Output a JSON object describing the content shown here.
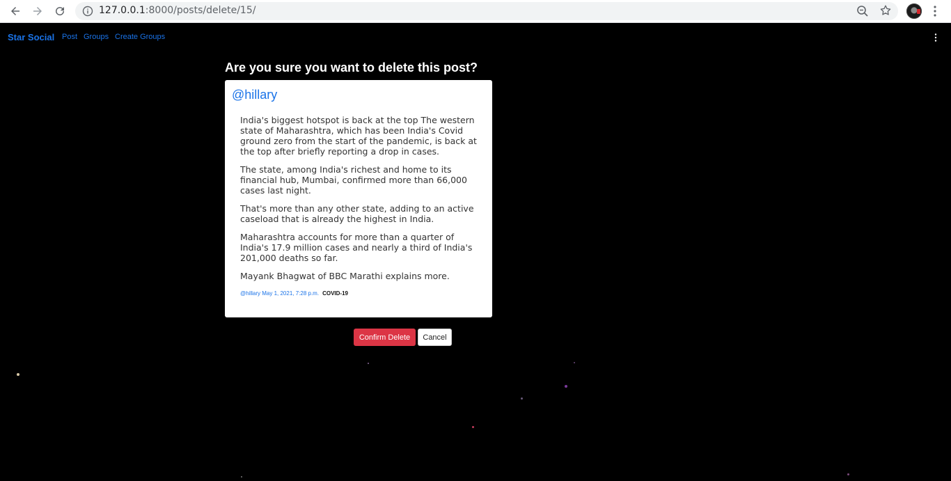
{
  "browser": {
    "url_host": "127.0.0.1",
    "url_path": ":8000/posts/delete/15/"
  },
  "navbar": {
    "brand": "Star Social",
    "links": [
      "Post",
      "Groups",
      "Create Groups"
    ]
  },
  "page": {
    "heading": "Are you sure you want to delete this post?"
  },
  "post": {
    "author": "@hillary",
    "paragraphs": [
      "India's biggest hotspot is back at the top The western state of Maharashtra, which has been India's Covid ground zero from the start of the pandemic, is back at the top after briefly reporting a drop in cases.",
      "The state, among India's richest and home to its financial hub, Mumbai, confirmed more than 66,000 cases last night.",
      "That's more than any other state, adding to an active caseload that is already the highest in India.",
      "Maharashtra accounts for more than a quarter of India's 17.9 million cases and nearly a third of India's 201,000 deaths so far.",
      "Mayank Bhagwat of BBC Marathi explains more."
    ],
    "meta_author_date": "@hillary May 1, 2021, 7:28 p.m.",
    "group": "COVID-19"
  },
  "buttons": {
    "confirm": "Confirm Delete",
    "cancel": "Cancel"
  },
  "colors": {
    "link_blue": "#1a73e8",
    "danger": "#dc3545",
    "background": "#000000"
  }
}
